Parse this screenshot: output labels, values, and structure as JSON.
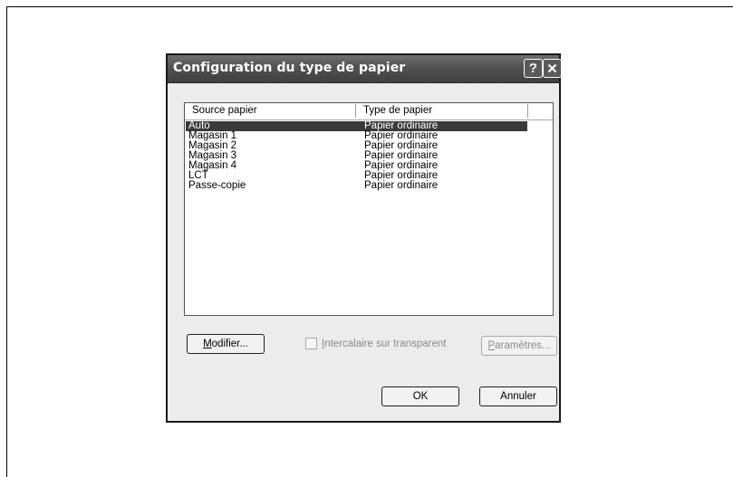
{
  "dialog": {
    "title": "Configuration du type de papier",
    "help_label": "?",
    "close_icon": "close-icon"
  },
  "list": {
    "columns": [
      "Source papier",
      "Type de papier"
    ],
    "rows": [
      {
        "source": "Auto",
        "type": "Papier ordinaire",
        "selected": true
      },
      {
        "source": "Magasin 1",
        "type": "Papier ordinaire"
      },
      {
        "source": "Magasin 2",
        "type": "Papier ordinaire"
      },
      {
        "source": "Magasin 3",
        "type": "Papier ordinaire"
      },
      {
        "source": "Magasin 4",
        "type": "Papier ordinaire"
      },
      {
        "source": "LCT",
        "type": "Papier ordinaire"
      },
      {
        "source": "Passe-copie",
        "type": "Papier ordinaire"
      }
    ]
  },
  "buttons": {
    "modifier": {
      "label": "Modifier...",
      "mnemonic": "M",
      "rest": "odifier..."
    },
    "parametres": {
      "label": "Paramètres...",
      "mnemonic": "P",
      "rest": "aramètres...",
      "enabled": false
    },
    "ok": "OK",
    "annuler": "Annuler"
  },
  "checkbox": {
    "label": "Intercalaire sur transparent",
    "mnemonic": "I",
    "rest": "ntercalaire sur transparent",
    "checked": false,
    "enabled": false
  }
}
